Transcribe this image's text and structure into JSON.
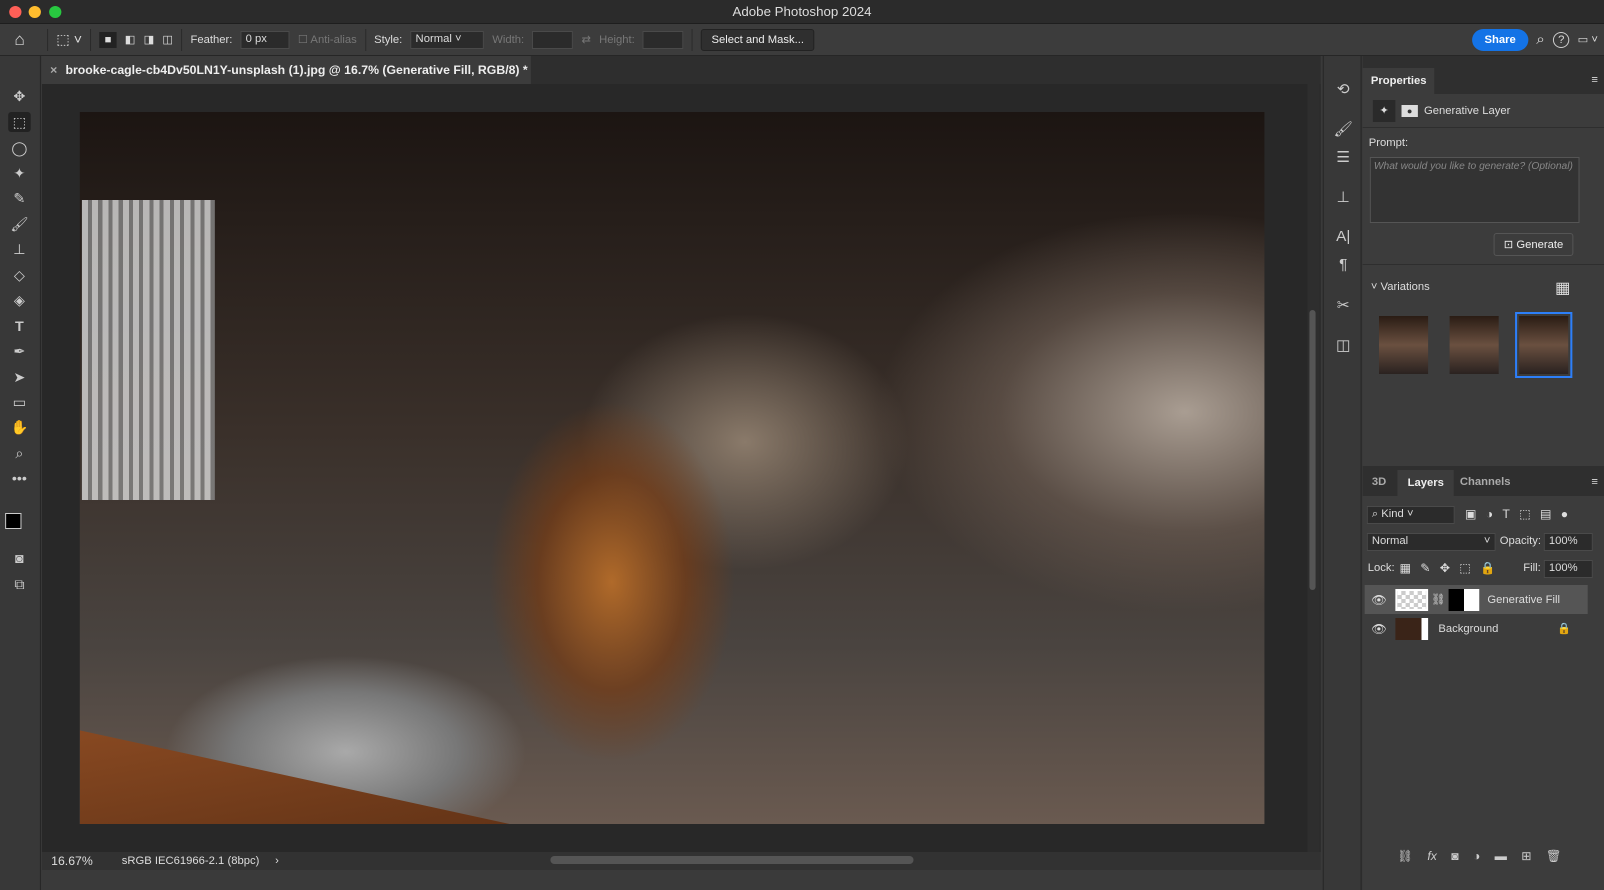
{
  "window": {
    "title": "Adobe Photoshop 2024"
  },
  "options": {
    "feather_label": "Feather:",
    "feather_value": "0 px",
    "antialias_label": "Anti-alias",
    "style_label": "Style:",
    "style_value": "Normal",
    "width_label": "Width:",
    "height_label": "Height:",
    "select_mask": "Select and Mask...",
    "share": "Share"
  },
  "document": {
    "tab_title": "brooke-cagle-cb4Dv50LN1Y-unsplash (1).jpg @ 16.7% (Generative Fill, RGB/8) *",
    "zoom": "16.67%",
    "color_profile": "sRGB IEC61966-2.1 (8bpc)"
  },
  "properties": {
    "tab": "Properties",
    "layer_type": "Generative Layer",
    "prompt_label": "Prompt:",
    "prompt_placeholder": "What would you like to generate? (Optional)",
    "generate": "Generate",
    "variations": "Variations",
    "selected_variation": 3
  },
  "layers_panel": {
    "tabs": [
      "3D",
      "Layers",
      "Channels"
    ],
    "active_tab": "Layers",
    "filter": "Kind",
    "blend_mode": "Normal",
    "opacity_label": "Opacity:",
    "opacity": "100%",
    "lock_label": "Lock:",
    "fill_label": "Fill:",
    "fill": "100%",
    "layers": [
      {
        "name": "Generative Fill",
        "visible": true,
        "selected": true
      },
      {
        "name": "Background",
        "visible": true,
        "locked": true
      }
    ]
  },
  "colors": {
    "accent": "#1473e6",
    "selection": "#2d7ff9"
  }
}
